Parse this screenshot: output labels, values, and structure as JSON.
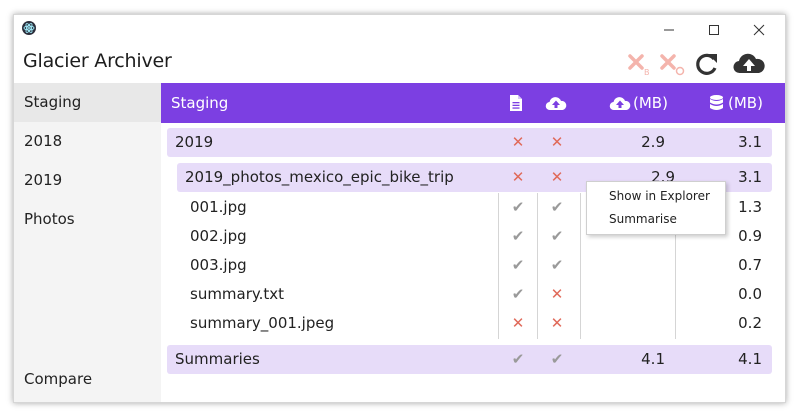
{
  "window": {
    "title": "Glacier Archiver",
    "controls": [
      "minimize",
      "maximize",
      "close"
    ]
  },
  "toolbar": {
    "icons": [
      "delete-backup-icon",
      "delete-archive-icon",
      "refresh-icon",
      "cloud-upload-icon"
    ]
  },
  "sidebar": {
    "items": [
      {
        "label": "Staging",
        "active": true
      },
      {
        "label": "2018"
      },
      {
        "label": "2019"
      },
      {
        "label": "Photos"
      },
      {
        "label": "Compare"
      }
    ]
  },
  "table": {
    "header": {
      "title": "Staging",
      "col_upload_mb": "(MB)",
      "col_disk_mb": "(MB)"
    },
    "rows": [
      {
        "name": "2019",
        "doc": "x",
        "cloud": "x",
        "upload_mb": "2.9",
        "disk_mb": "3.1"
      },
      {
        "name": "2019_photos_mexico_epic_bike_trip",
        "doc": "x",
        "cloud": "x",
        "upload_mb": "2.9",
        "disk_mb": "3.1"
      },
      {
        "name": "001.jpg",
        "doc": "check",
        "cloud": "check",
        "upload_mb": "",
        "disk_mb": "1.3"
      },
      {
        "name": "002.jpg",
        "doc": "check",
        "cloud": "check",
        "upload_mb": "",
        "disk_mb": "0.9"
      },
      {
        "name": "003.jpg",
        "doc": "check",
        "cloud": "check",
        "upload_mb": "",
        "disk_mb": "0.7"
      },
      {
        "name": "summary.txt",
        "doc": "check",
        "cloud": "x",
        "upload_mb": "",
        "disk_mb": "0.0"
      },
      {
        "name": "summary_001.jpeg",
        "doc": "x",
        "cloud": "x",
        "upload_mb": "",
        "disk_mb": "0.2"
      },
      {
        "name": "Summaries",
        "doc": "check",
        "cloud": "check",
        "upload_mb": "4.1",
        "disk_mb": "4.1"
      }
    ]
  },
  "context_menu": {
    "items": [
      "Show in Explorer",
      "Summarise"
    ]
  },
  "colors": {
    "header": "#7c3fe2",
    "group_row": "#e7dcf9",
    "cross": "#e06a5a",
    "check": "#9a9a9a"
  }
}
